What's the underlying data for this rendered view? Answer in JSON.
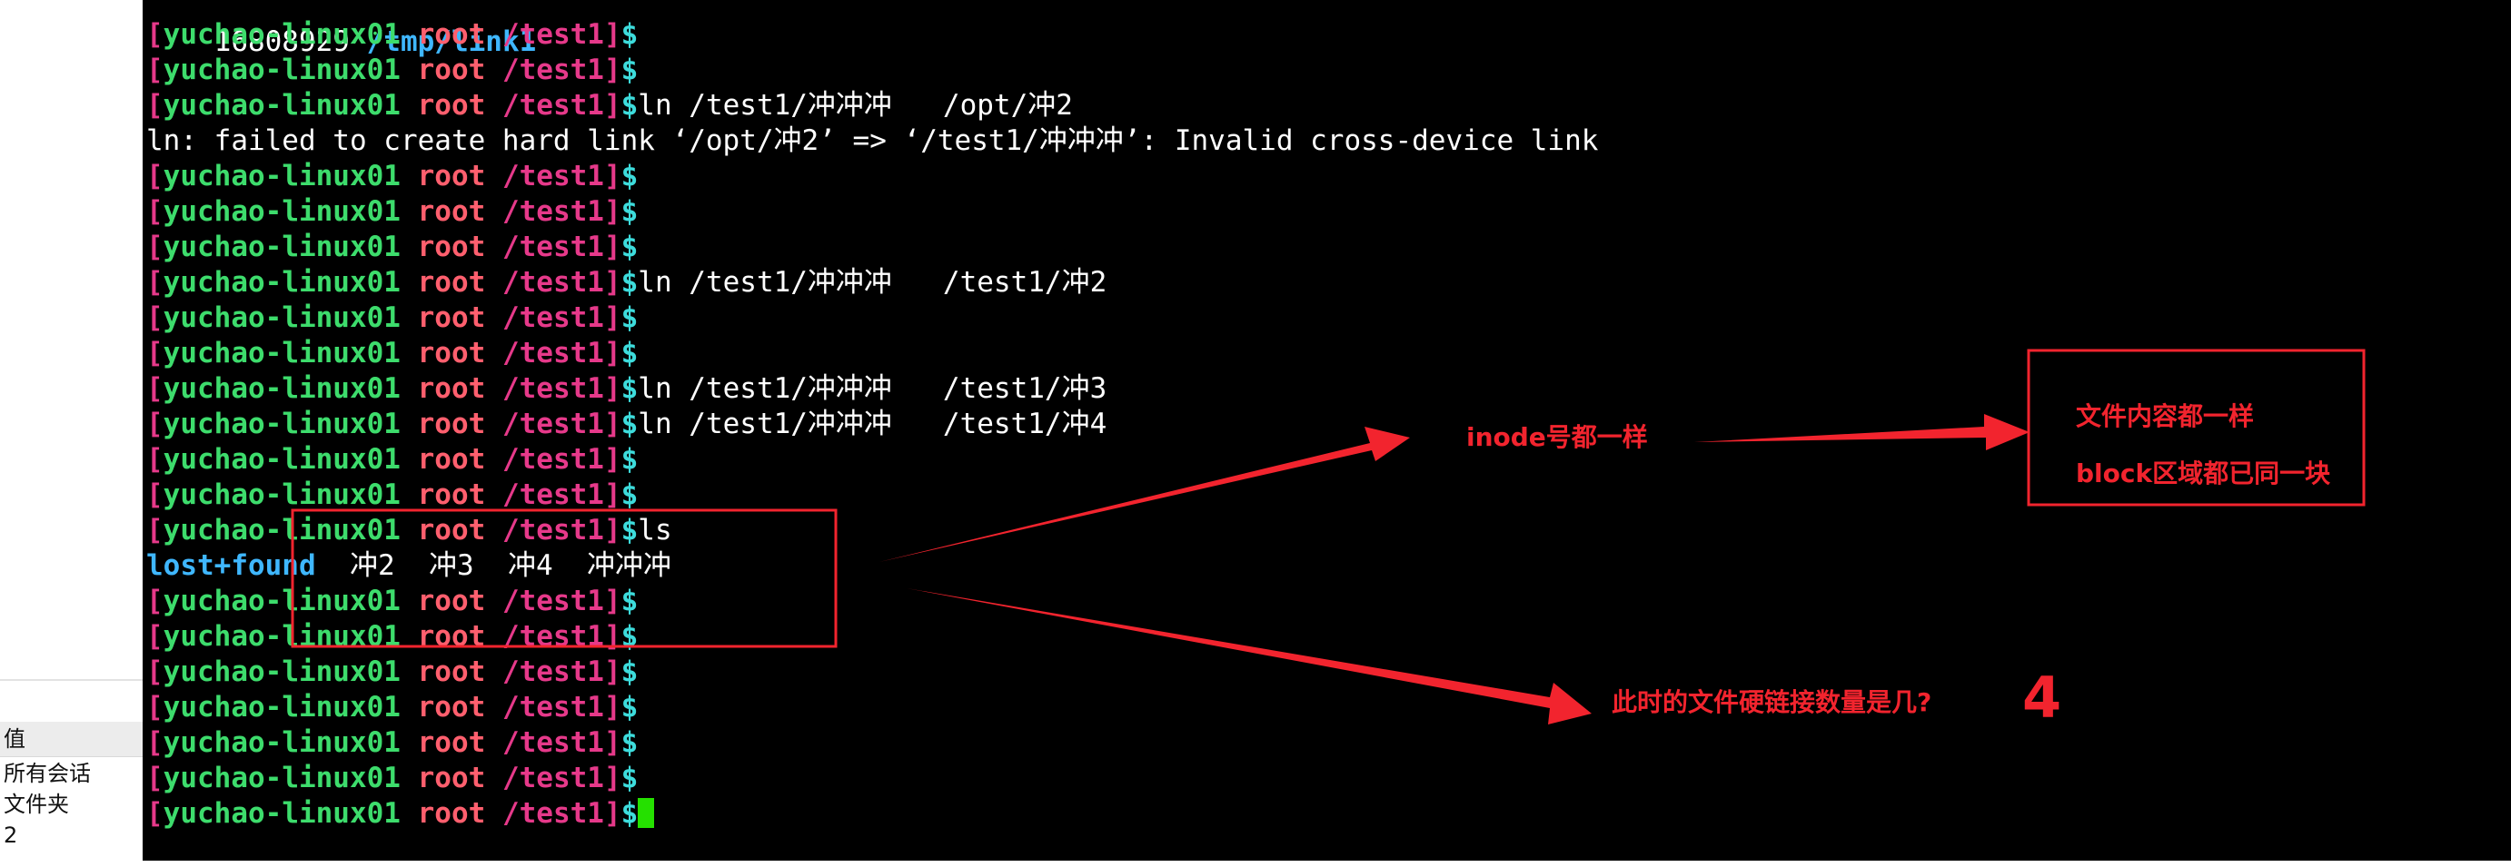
{
  "side_panel": {
    "header": "值",
    "rows": [
      "所有会话",
      "文件夹",
      "2"
    ]
  },
  "terminal": {
    "top_line_number": "16808929 ",
    "top_line_path": "/tmp/link1",
    "prompt": {
      "open_bracket": "[",
      "host": "yuchao-linux01",
      "user": "root",
      "path": "/test1]",
      "dollar": "$"
    },
    "lines": [
      {
        "cmd": ""
      },
      {
        "cmd": ""
      },
      {
        "cmd": "ln /test1/冲冲冲   /opt/冲2"
      },
      {
        "output": "ln: failed to create hard link ‘/opt/冲2’ => ‘/test1/冲冲冲’: Invalid cross-device link"
      },
      {
        "cmd": ""
      },
      {
        "cmd": ""
      },
      {
        "cmd": ""
      },
      {
        "cmd": "ln /test1/冲冲冲   /test1/冲2"
      },
      {
        "cmd": ""
      },
      {
        "cmd": ""
      },
      {
        "cmd": "ln /test1/冲冲冲   /test1/冲3"
      },
      {
        "cmd": "ln /test1/冲冲冲   /test1/冲4"
      },
      {
        "cmd": ""
      },
      {
        "cmd": ""
      },
      {
        "cmd": "ls"
      },
      {
        "ls_output": true
      },
      {
        "cmd": ""
      },
      {
        "cmd": ""
      },
      {
        "cmd": ""
      },
      {
        "cmd": ""
      },
      {
        "cmd": ""
      },
      {
        "cmd": ""
      },
      {
        "cmd": "",
        "cursor": true
      }
    ],
    "ls_output": {
      "dir": "lost+found",
      "files": "  冲2  冲3  冲4  冲冲冲"
    }
  },
  "annotations": {
    "inode_note": "inode号都一样",
    "content_note_1": "文件内容都一样",
    "content_note_2": "block区域都已同一块",
    "question": "此时的文件硬链接数量是几?",
    "answer": "4",
    "color": "#f2242e"
  },
  "colors": {
    "terminal_bg": "#000000",
    "bracket": "#e6398a",
    "host": "#3ddc6c",
    "user": "#ff5f6e",
    "dollar": "#3ddcdc",
    "directory": "#3fb7ff",
    "cursor": "#25e000"
  }
}
